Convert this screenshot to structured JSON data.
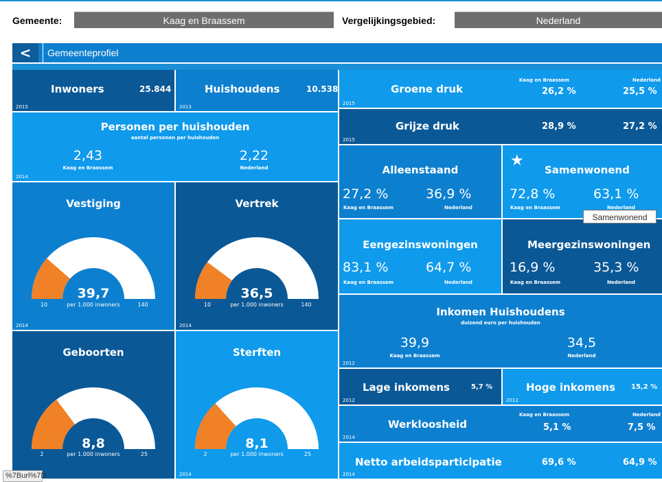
{
  "header": {
    "gemeente_label": "Gemeente:",
    "gemeente_value": "Kaag en Braassem",
    "vergelijking_label": "Vergelijkingsgebied:",
    "vergelijking_value": "Nederland"
  },
  "nav": {
    "back": "<",
    "title": "Gemeenteprofiel"
  },
  "tiles": {
    "inwoners": {
      "title": "Inwoners",
      "value": "25.844",
      "year": "2015"
    },
    "huishoudens": {
      "title": "Huishoudens",
      "value": "10.538",
      "year": "2013"
    },
    "pph": {
      "title": "Personen per huishouden",
      "subtitle": "aantal personen per huishouden",
      "local_value": "2,43",
      "local_label": "Kaag en Braassem",
      "nl_value": "2,22",
      "nl_label": "Nederland",
      "year": "2014"
    },
    "vestiging": {
      "title": "Vestiging",
      "value": "39,7",
      "unit": "per 1.000 inwoners",
      "min": "10",
      "max": "140",
      "fill_fraction": 0.228,
      "year": "2014"
    },
    "vertrek": {
      "title": "Vertrek",
      "value": "36,5",
      "unit": "per 1.000 inwoners",
      "min": "10",
      "max": "140",
      "fill_fraction": 0.204,
      "year": "2014"
    },
    "geboorten": {
      "title": "Geboorten",
      "value": "8,8",
      "unit": "per 1.000 inwoners",
      "min": "2",
      "max": "25",
      "fill_fraction": 0.296,
      "year": "2014"
    },
    "sterften": {
      "title": "Sterften",
      "value": "8,1",
      "unit": "per 1.000 inwoners",
      "min": "2",
      "max": "25",
      "fill_fraction": 0.265,
      "year": "2014"
    },
    "groene_druk": {
      "title": "Groene druk",
      "local_label": "Kaag en Braassem",
      "local_value": "26,2 %",
      "nl_label": "Nederland",
      "nl_value": "25,5 %",
      "year": "2015"
    },
    "grijze_druk": {
      "title": "Grijze druk",
      "local_value": "28,9 %",
      "nl_value": "27,2 %",
      "year": "2015"
    },
    "alleenstaand": {
      "title": "Alleenstaand",
      "local_value": "27,2 %",
      "local_label": "Kaag en Braassem",
      "nl_value": "36,9 %",
      "nl_label": "Nederland"
    },
    "samenwonend": {
      "title": "Samenwonend",
      "local_value": "72,8 %",
      "local_label": "Kaag en Braassem",
      "nl_value": "63,1 %",
      "nl_label": "Nederland"
    },
    "eengezins": {
      "title": "Eengezinswoningen",
      "local_value": "83,1 %",
      "local_label": "Kaag en Braassem",
      "nl_value": "64,7 %",
      "nl_label": "Nederland"
    },
    "meergezins": {
      "title": "Meergezinswoningen",
      "local_value": "16,9 %",
      "local_label": "Kaag en Braassem",
      "nl_value": "35,3 %",
      "nl_label": "Nederland"
    },
    "inkomen": {
      "title": "Inkomen Huishoudens",
      "subtitle": "duizend euro per huishouden",
      "local_value": "39,9",
      "local_label": "Kaag en Braassem",
      "nl_value": "34,5",
      "nl_label": "Nederland",
      "year": "2012"
    },
    "lage_inkomens": {
      "title": "Lage inkomens",
      "value": "5,7 %",
      "year": "2012"
    },
    "hoge_inkomens": {
      "title": "Hoge inkomens",
      "value": "15,2 %",
      "year": "2012"
    },
    "werkloosheid": {
      "title": "Werkloosheid",
      "local_label": "Kaag en Braassem",
      "local_value": "5,1 %",
      "nl_label": "Nederland",
      "nl_value": "7,5 %",
      "year": "2014"
    },
    "arbeid": {
      "title": "Netto arbeidsparticipatie",
      "local_value": "69,6 %",
      "nl_value": "64,9 %",
      "year": "2014"
    }
  },
  "tooltip": "Samenwonend",
  "status_bar": "%7Burl%7D",
  "colors": {
    "dark": "#0b5896",
    "mid": "#0d7fcf",
    "light": "#0f9aec",
    "gauge_fill": "#f08127",
    "gauge_track": "#ffffff"
  }
}
